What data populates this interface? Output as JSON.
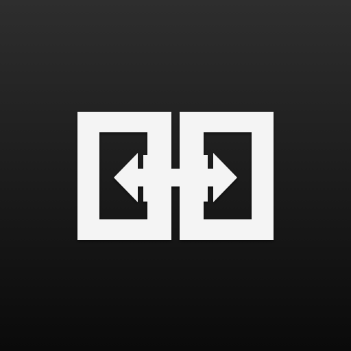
{
  "icon": {
    "name": "bidirectional-link-icon",
    "glyph_color": "#f4f4f4",
    "background_top_color": "#2e2e2e",
    "background_bottom_color": "#0a0a0a"
  }
}
